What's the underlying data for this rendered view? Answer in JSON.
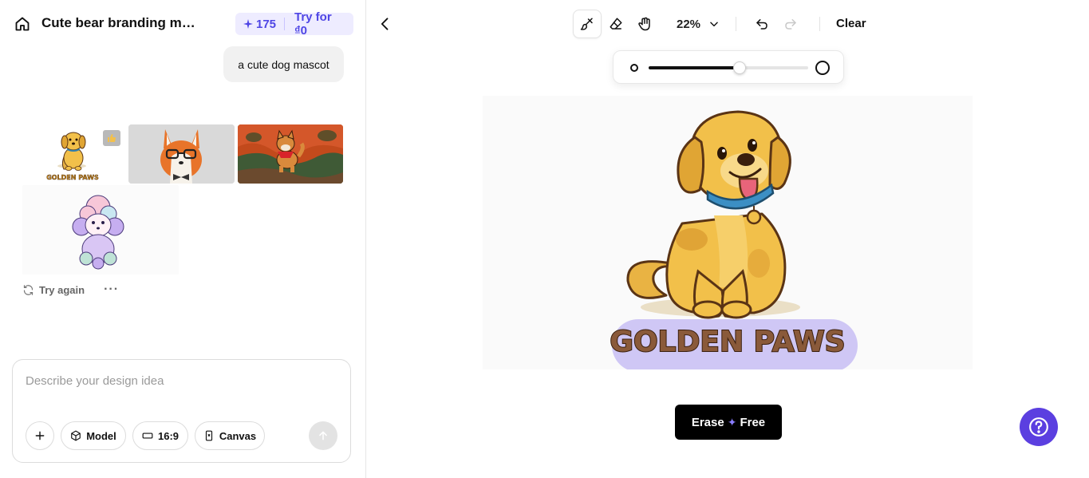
{
  "header": {
    "title": "Cute bear branding mascot",
    "credits_count": "175",
    "try_label": "Try for ₫0"
  },
  "chat": {
    "user_message": "a cute dog mascot",
    "thumbnails": [
      {
        "name": "golden-dog",
        "caption": "GOLDEN PAWS"
      },
      {
        "name": "corgi-glasses"
      },
      {
        "name": "shiba-scarf"
      },
      {
        "name": "pastel-poodle"
      }
    ],
    "try_again_label": "Try again",
    "more_label": "···"
  },
  "composer": {
    "placeholder": "Describe your design idea",
    "model_label": "Model",
    "ratio_label": "16:9",
    "canvas_label": "Canvas"
  },
  "toolbar": {
    "zoom_label": "22%",
    "clear_label": "Clear"
  },
  "brush": {
    "size_fraction": 0.57
  },
  "canvas": {
    "logo_text": "GOLDEN PAWS"
  },
  "actions": {
    "erase_label": "Erase",
    "free_label": "Free",
    "spark": "✦"
  },
  "colors": {
    "accent": "#4f46e5",
    "help": "#5b3fe0",
    "dog_fur": "#f2c04a",
    "badge_bg": "#cfc7f5",
    "logo_text": "#8a5a3a"
  }
}
